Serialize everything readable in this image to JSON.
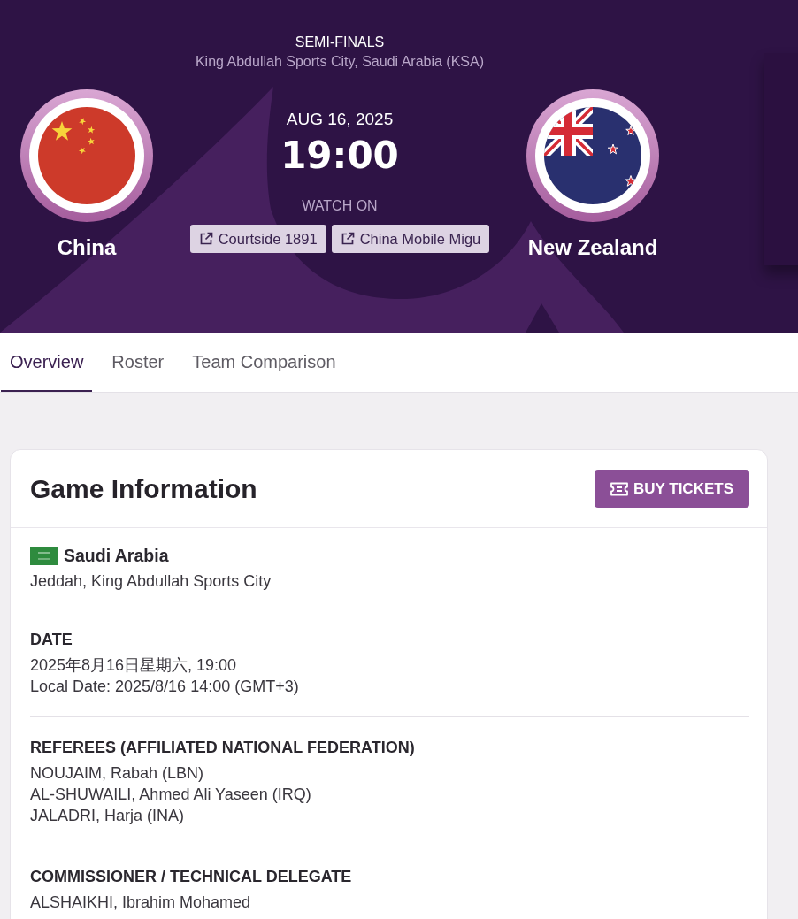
{
  "match_header": {
    "round": "SEMI-FINALS",
    "venue": "King Abdullah Sports City, Saudi Arabia (KSA)",
    "teams": [
      {
        "name": "China",
        "kind": "cn"
      },
      {
        "name": "New Zealand",
        "kind": "nz"
      }
    ],
    "date": "AUG 16, 2025",
    "time": "19:00",
    "watch_label": "WATCH ON",
    "streams": [
      "Courtside 1891",
      "China Mobile Migu"
    ]
  },
  "tabs": [
    {
      "label": "Overview",
      "selected": true
    },
    {
      "label": "Roster",
      "selected": false
    },
    {
      "label": "Team Comparison",
      "selected": false
    }
  ],
  "game_info": {
    "title": "Game Information",
    "button": "BUY TICKETS",
    "sections": [
      {
        "kind": "venue",
        "heading": "Saudi Arabia",
        "lines": [
          "Jeddah, King Abdullah Sports City"
        ]
      },
      {
        "kind": "field",
        "heading": "DATE",
        "lines": [
          "2025年8月16日星期六, 19:00",
          "Local Date: 2025/8/16 14:00 (GMT+3)"
        ]
      },
      {
        "kind": "field",
        "heading": "REFEREES (AFFILIATED NATIONAL FEDERATION)",
        "lines": [
          "NOUJAIM, Rabah (LBN)",
          "AL-SHUWAILI, Ahmed Ali Yaseen (IRQ)",
          "JALADRI, Harja (INA)"
        ]
      },
      {
        "kind": "field",
        "heading": "COMMISSIONER / TECHNICAL DELEGATE",
        "lines": [
          "ALSHAIKHI, Ibrahim Mohamed"
        ]
      }
    ]
  }
}
